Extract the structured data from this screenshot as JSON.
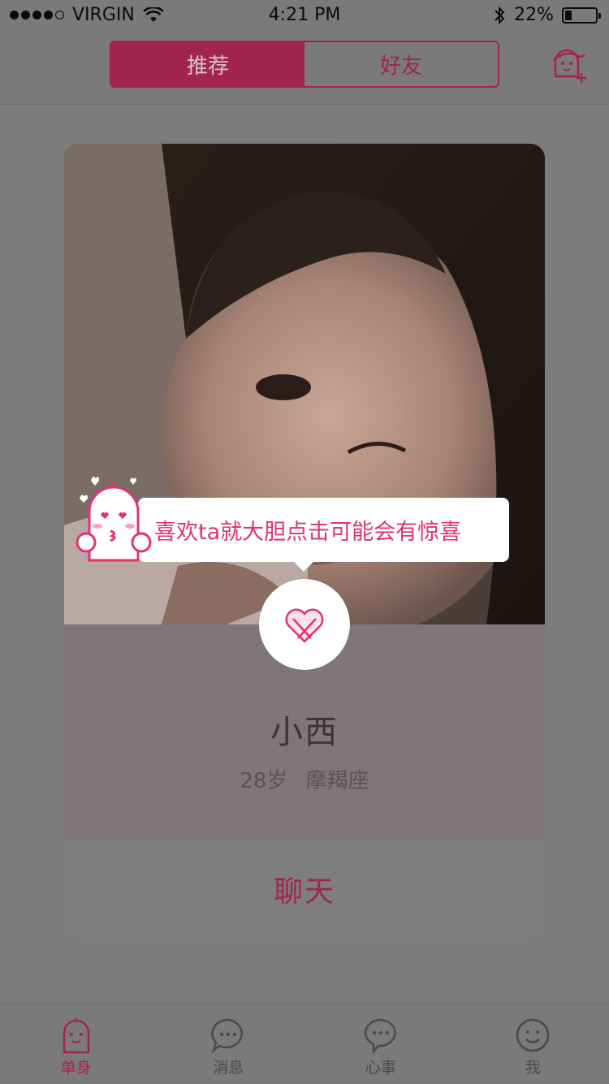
{
  "status_bar": {
    "carrier": "VIRGIN",
    "time": "4:21 PM",
    "battery_percent": "22%",
    "battery_level": 0.22
  },
  "nav": {
    "tabs": [
      {
        "label": "推荐",
        "active": true
      },
      {
        "label": "好友",
        "active": false
      }
    ],
    "add_friend_icon": "add-friend-icon"
  },
  "card": {
    "name": "小西",
    "age": "28岁",
    "zodiac": "摩羯座",
    "chat_label": "聊天"
  },
  "tooltip": {
    "text": "喜欢ta就大胆点击可能会有惊喜"
  },
  "tabbar": {
    "items": [
      {
        "label": "单身",
        "icon": "single-icon",
        "active": true
      },
      {
        "label": "消息",
        "icon": "message-icon",
        "active": false
      },
      {
        "label": "心事",
        "icon": "heart-talk-icon",
        "active": false
      },
      {
        "label": "我",
        "icon": "profile-icon",
        "active": false
      }
    ]
  },
  "colors": {
    "accent": "#e1336e",
    "accent_dimmed": "#a1254e"
  }
}
